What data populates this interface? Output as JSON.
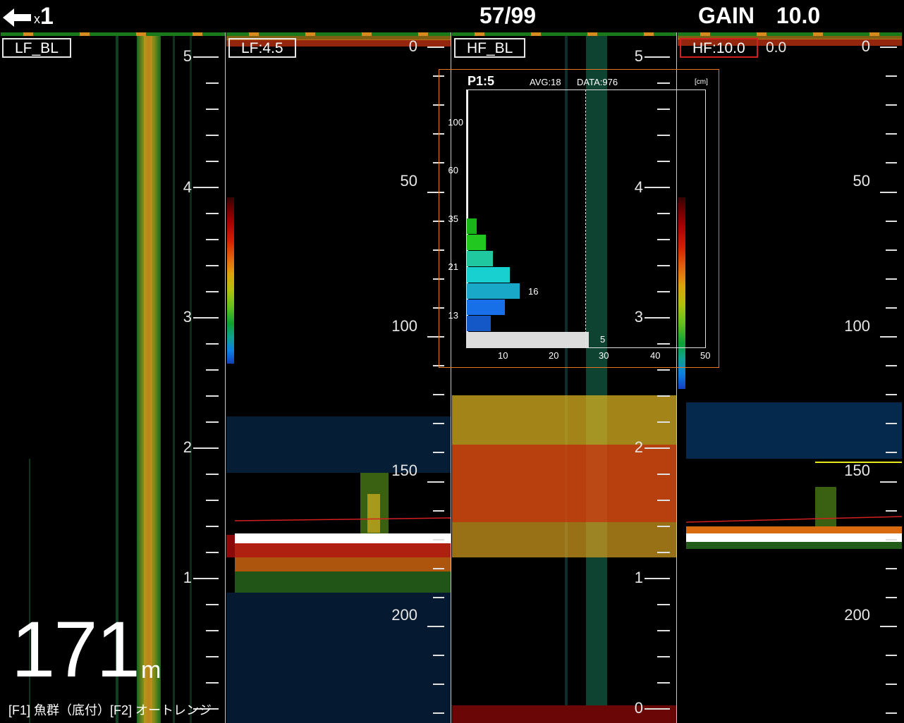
{
  "topbar": {
    "back_icon": "arrow-left-icon",
    "multiplier_x": "x",
    "multiplier_num": "1",
    "counter": "57/99",
    "gain_label": "GAIN",
    "gain_value": "10.0"
  },
  "panels": [
    {
      "tag": "LF_BL",
      "scale": [
        "5",
        "4",
        "3",
        "2",
        "1"
      ]
    },
    {
      "tag": "LF:4.5",
      "scale": [
        "0",
        "50",
        "100",
        "150",
        "200"
      ]
    },
    {
      "tag": "HF_BL",
      "scale": [
        "5",
        "4",
        "3",
        "2",
        "1",
        "0"
      ]
    },
    {
      "tag": "HF:10.0",
      "offset": "0.0",
      "scale": [
        "0",
        "50",
        "100",
        "150",
        "200"
      ]
    }
  ],
  "depth": {
    "value": "171",
    "unit": "m"
  },
  "function_keys": "[F1] 魚群（底付）[F2] オートレンジ",
  "colors": {
    "accent_orange": "#e8761f",
    "marker_red": "#d21f1f",
    "bottom_white": "#ffffff"
  },
  "histogram": {
    "title": "P1:5",
    "avg": "AVG:18",
    "data": "DATA:976",
    "unit": "[cm]",
    "y_labels": [
      "100",
      "60",
      "35",
      "21",
      "13"
    ],
    "x_labels": [
      "10",
      "20",
      "30",
      "40",
      "50"
    ],
    "bars": [
      {
        "value": 2,
        "color": "#18b418"
      },
      {
        "value": 4,
        "color": "#20c820"
      },
      {
        "value": 5.5,
        "color": "#20c8a0"
      },
      {
        "value": 9,
        "color": "#18d0d0"
      },
      {
        "value": 11,
        "color": "#1aa8c8"
      },
      {
        "value": 8,
        "color": "#1870e8"
      },
      {
        "value": 5,
        "color": "#1458c8"
      },
      {
        "value": 25.5,
        "color": "#dcdcdc"
      }
    ],
    "bar_labels": [
      "16",
      "5"
    ],
    "x_max": 50
  }
}
